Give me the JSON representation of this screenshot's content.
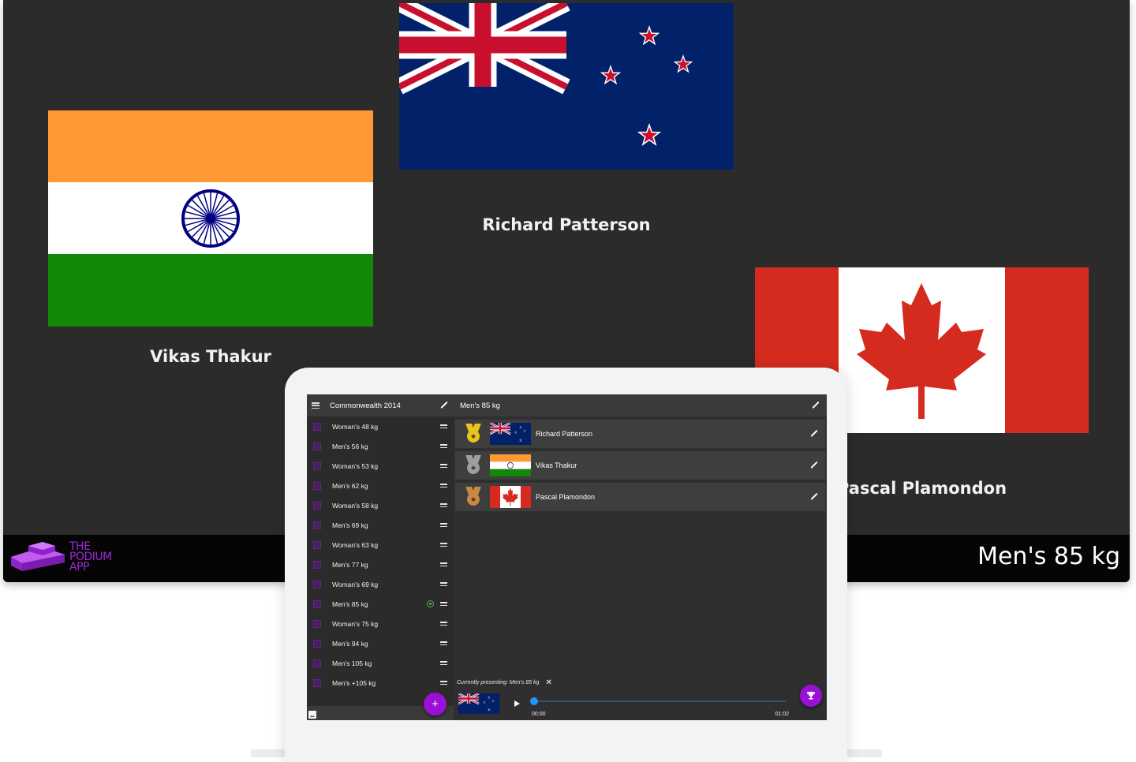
{
  "presentation": {
    "podium": [
      {
        "place": "first",
        "name": "Richard Patterson",
        "country": "New Zealand",
        "flag": "nz-flag"
      },
      {
        "place": "second",
        "name": "Vikas Thakur",
        "country": "India",
        "flag": "india-flag"
      },
      {
        "place": "third",
        "name": "Pascal Plamondon",
        "country": "Canada",
        "flag": "canada-flag"
      }
    ],
    "logo_lines": [
      "THE",
      "PODIUM",
      "APP"
    ],
    "event_title": "Men's 85 kg"
  },
  "app": {
    "sidebar": {
      "title": "Commonwealth 2014",
      "menu_icon": "hamburger-icon",
      "edit_icon": "pencil-icon",
      "categories": [
        {
          "label": "Woman's 48 kg",
          "live": false
        },
        {
          "label": "Men's 56 kg",
          "live": false
        },
        {
          "label": "Woman's 53 kg",
          "live": false
        },
        {
          "label": "Men's 62 kg",
          "live": false
        },
        {
          "label": "Woman's 58 kg",
          "live": false
        },
        {
          "label": "Men's 69 kg",
          "live": false
        },
        {
          "label": "Woman's 63 kg",
          "live": false
        },
        {
          "label": "Men's 77 kg",
          "live": false
        },
        {
          "label": "Woman's 69 kg",
          "live": false
        },
        {
          "label": "Men's 85 kg",
          "live": true
        },
        {
          "label": "Woman's 75 kg",
          "live": false
        },
        {
          "label": "Men's 94 kg",
          "live": false
        },
        {
          "label": "Men's 105 kg",
          "live": false
        },
        {
          "label": "Men's +105 kg",
          "live": false
        }
      ],
      "add_button": "+"
    },
    "main": {
      "title": "Men's 85 kg",
      "results": [
        {
          "medal": "gold",
          "name": "Richard Patterson",
          "flag": "nz-flag"
        },
        {
          "medal": "silver",
          "name": "Vikas Thakur",
          "flag": "india-flag"
        },
        {
          "medal": "bronze",
          "name": "Pascal Plamondon",
          "flag": "canada-flag"
        }
      ],
      "presenting_text": "Currently presenting: Men's 85 kg",
      "close_label": "✕",
      "player": {
        "current_time": "00:00",
        "duration": "01:02",
        "progress": 0
      }
    }
  },
  "colors": {
    "accent_purple": "#9b10d6",
    "gold": "#e8c51c",
    "silver": "#9e9e9e",
    "bronze": "#c98a3e",
    "progress_blue": "#2196f3",
    "live_green": "#4caf50"
  }
}
